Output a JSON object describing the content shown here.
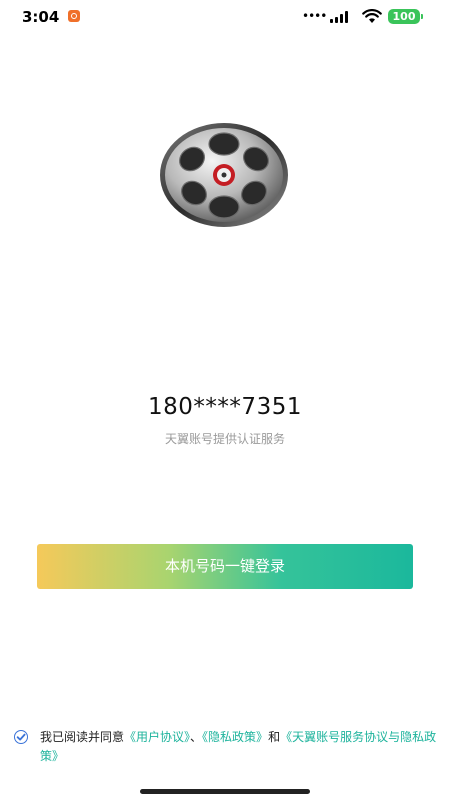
{
  "status_bar": {
    "time": "3:04",
    "battery": "100",
    "battery_color": "#3ac45a"
  },
  "logo": {
    "icon": "film-reel-icon"
  },
  "phone": {
    "masked_number": "180****7351",
    "provider_text": "天翼账号提供认证服务"
  },
  "login": {
    "button_label": "本机号码一键登录",
    "gradient": [
      "#f5c95a",
      "#1bb89c"
    ]
  },
  "agreement": {
    "checked": true,
    "prefix": "我已阅读并同意",
    "link_user": "《用户协议》",
    "sep1": "、",
    "link_privacy": "《隐私政策》",
    "and": "和",
    "link_tianyi": "《天翼账号服务协议与隐私政策》",
    "accent_color": "#1db39c"
  }
}
